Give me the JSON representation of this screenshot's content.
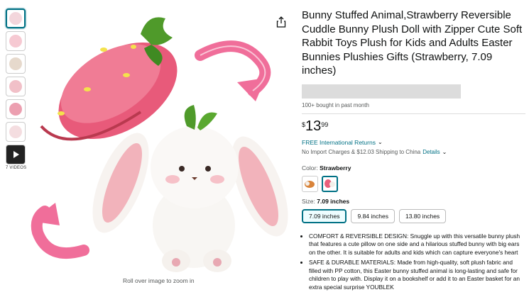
{
  "thumbnails": {
    "video_label": "7 VIDEOS"
  },
  "main_image": {
    "zoom_hint": "Roll over image to zoom in"
  },
  "product": {
    "title": "Bunny Stuffed Animal,Strawberry Reversible Cuddle Bunny Plush Doll with Zipper Cute Soft Rabbit Toys Plush for Kids and Adults Easter Bunnies Plushies Gifts (Strawberry, 7.09 inches)",
    "bought_text": "100+ bought in past month",
    "price": {
      "symbol": "$",
      "whole": "13",
      "fraction": "99"
    },
    "returns_text": "FREE International Returns",
    "import_text": "No Import Charges & $12.03 Shipping to China",
    "details_link": "Details",
    "color_label": "Color:",
    "color_value": "Strawberry",
    "size_label": "Size:",
    "size_value": "7.09 inches",
    "sizes": [
      "7.09 inches",
      "9.84 inches",
      "13.80 inches"
    ],
    "bullets": [
      "COMFORT & REVERSIBLE DESIGN: Snuggle up with this versatile bunny plush that features a cute pillow on one side and a hilarious stuffed bunny with big ears on the other. It is suitable for adults and kids which can capture everyone's heart",
      "SAFE & DURABLE MATERIALS: Made from high-quality, soft plush fabric and filled with PP cotton, this Easter bunny stuffed animal is long-lasting and safe for children to play with. Display it on a bookshelf or add it to an Easter basket for an extra special surprise YOUBLEK"
    ]
  },
  "colors": {
    "accent": "#007185",
    "strawberry_pink": "#e8607c",
    "leaf_green": "#4f9a2a"
  }
}
